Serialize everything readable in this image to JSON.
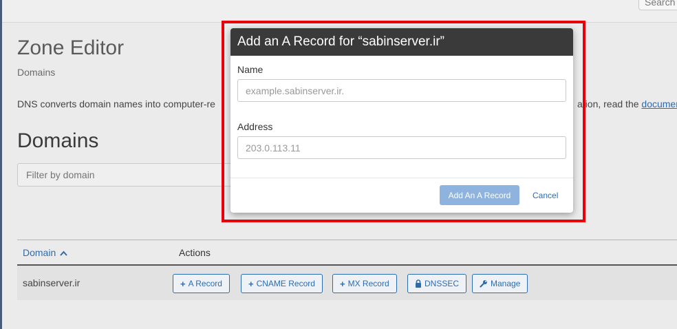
{
  "header": {
    "search_label": "Search"
  },
  "page": {
    "title": "Zone Editor",
    "breadcrumb": "Domains",
    "description_left": "DNS converts domain names into computer-re",
    "description_right": "ation, read the ",
    "doc_link": "documen",
    "section_title": "Domains",
    "filter_placeholder": "Filter by domain"
  },
  "table": {
    "col_domain": "Domain",
    "col_actions": "Actions",
    "rows": [
      {
        "domain": "sabinserver.ir",
        "actions": {
          "a_record": "A Record",
          "cname_record": "CNAME Record",
          "mx_record": "MX Record",
          "dnssec": "DNSSEC",
          "manage": "Manage"
        }
      }
    ]
  },
  "modal": {
    "title": "Add an A Record for “sabinserver.ir”",
    "name_label": "Name",
    "name_placeholder": "example.sabinserver.ir.",
    "address_label": "Address",
    "address_placeholder": "203.0.113.11",
    "submit_label": "Add An A Record",
    "cancel_label": "Cancel"
  },
  "icons": {
    "plus": "plus-icon",
    "lock": "lock-icon",
    "wrench": "wrench-icon",
    "sort": "chevron-up-icon"
  },
  "colors": {
    "accent": "#2b6cb0",
    "highlight": "#e8000b",
    "modal_header": "#3a3a3a",
    "primary_button": "#8fb3df"
  }
}
